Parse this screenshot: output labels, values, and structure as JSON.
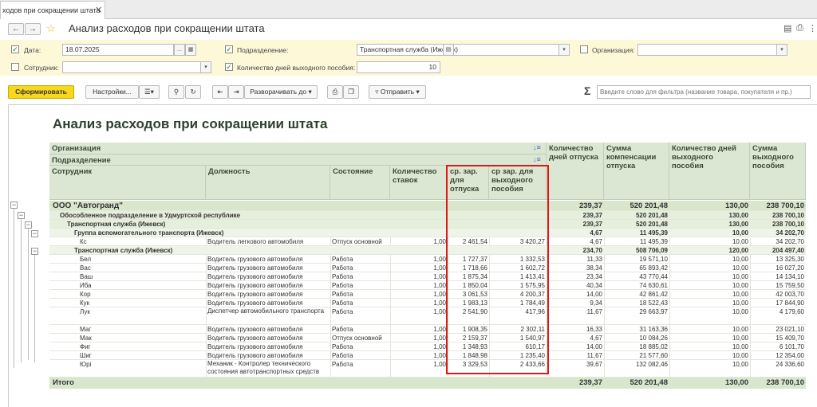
{
  "tab": {
    "title": "ходов при сокращении штата",
    "close": "✕"
  },
  "form": {
    "title": "Анализ расходов при сокращении штата"
  },
  "params": {
    "date_label": "Дата:",
    "date_value": "18.07.2025",
    "employee_label": "Сотрудник:",
    "employee_value": "",
    "division_label": "Подразделение:",
    "division_value": "Транспортная служба (Ижевск)",
    "org_label": "Организация:",
    "org_value": "",
    "days_label": "Количество дней выходного пособия:",
    "days_value": "10"
  },
  "toolbar": {
    "generate": "Сформировать",
    "settings": "Настройки...",
    "expand": "Разворачивать до",
    "send": "Отправить",
    "filter_placeholder": "Введите слово для фильтра (название товара, покупателя и пр.)",
    "sum_icon": "Σ"
  },
  "report": {
    "title": "Анализ расходов при сокращении штата",
    "headers": {
      "org": "Организация",
      "division": "Подразделение",
      "employee": "Сотрудник",
      "position": "Должность",
      "status": "Состояние",
      "rate": "Количество ставок",
      "avg_vac": "ср. зар. для отпуска",
      "avg_sev": "ср зар. для выходного пособия",
      "vac_days": "Количество дней отпуска",
      "vac_comp": "Сумма компенсации отпуска",
      "sev_days": "Количество дней выходного пособия",
      "sev_sum": "Сумма выходного пособия"
    },
    "groups": [
      {
        "label": "ООО \"Автогранд\"",
        "vac_days": "239,37",
        "vac_comp": "520 201,48",
        "sev_days": "130,00",
        "sev_sum": "238 700,10"
      },
      {
        "label": "Обособленное подразделение в Удмуртской республике",
        "vac_days": "239,37",
        "vac_comp": "520 201,48",
        "sev_days": "130,00",
        "sev_sum": "238 700,10"
      },
      {
        "label": "Транспортная служба (Ижевск)",
        "vac_days": "239,37",
        "vac_comp": "520 201,48",
        "sev_days": "130,00",
        "sev_sum": "238 700,10"
      },
      {
        "label": "Группа вспомогательного транспорта (Ижевск)",
        "vac_days": "4,67",
        "vac_comp": "11 495,39",
        "sev_days": "10,00",
        "sev_sum": "34 202,70"
      },
      {
        "label": "Транспортная служба (Ижевск)",
        "vac_days": "234,70",
        "vac_comp": "508 706,09",
        "sev_days": "120,00",
        "sev_sum": "204 497,40"
      }
    ],
    "rows": [
      {
        "emp": "Кс",
        "pos": "Водитель легкового автомобиля",
        "status": "Отпуск основной",
        "rate": "1,00",
        "avg_vac": "2 461,54",
        "avg_sev": "3 420,27",
        "vac_days": "4,67",
        "vac_comp": "11 495,39",
        "sev_days": "10,00",
        "sev_sum": "34 202,70"
      },
      {
        "emp": "Бел",
        "pos": "Водитель грузового автомобиля",
        "status": "Работа",
        "rate": "1,00",
        "avg_vac": "1 727,37",
        "avg_sev": "1 332,53",
        "vac_days": "11,33",
        "vac_comp": "19 571,10",
        "sev_days": "10,00",
        "sev_sum": "13 325,30"
      },
      {
        "emp": "Вас",
        "pos": "Водитель грузового автомобиля",
        "status": "Работа",
        "rate": "1,00",
        "avg_vac": "1 718,66",
        "avg_sev": "1 602,72",
        "vac_days": "38,34",
        "vac_comp": "65 893,42",
        "sev_days": "10,00",
        "sev_sum": "16 027,20"
      },
      {
        "emp": "Ваш",
        "pos": "Водитель грузового автомобиля",
        "status": "Работа",
        "rate": "1,00",
        "avg_vac": "1 875,34",
        "avg_sev": "1 413,41",
        "vac_days": "23,34",
        "vac_comp": "43 770,44",
        "sev_days": "10,00",
        "sev_sum": "14 134,10"
      },
      {
        "emp": "Иба",
        "pos": "Водитель грузового автомобиля",
        "status": "Работа",
        "rate": "1,00",
        "avg_vac": "1 850,04",
        "avg_sev": "1 575,95",
        "vac_days": "40,34",
        "vac_comp": "74 630,61",
        "sev_days": "10,00",
        "sev_sum": "15 759,50"
      },
      {
        "emp": "Кор",
        "pos": "Водитель грузового автомобиля",
        "status": "Работа",
        "rate": "1,00",
        "avg_vac": "3 061,53",
        "avg_sev": "4 200,37",
        "vac_days": "14,00",
        "vac_comp": "42 861,42",
        "sev_days": "10,00",
        "sev_sum": "42 003,70"
      },
      {
        "emp": "Кук",
        "pos": "Водитель грузового автомобиля",
        "status": "Работа",
        "rate": "1,00",
        "avg_vac": "1 983,13",
        "avg_sev": "1 784,49",
        "vac_days": "9,34",
        "vac_comp": "18 522,43",
        "sev_days": "10,00",
        "sev_sum": "17 844,90"
      },
      {
        "emp": "Лук",
        "pos": "Диспетчер автомобильного транспорта",
        "status": "Работа",
        "rate": "1,00",
        "avg_vac": "2 541,90",
        "avg_sev": "417,96",
        "vac_days": "11,67",
        "vac_comp": "29 663,97",
        "sev_days": "10,00",
        "sev_sum": "4 179,60"
      },
      {
        "emp": "Маг",
        "pos": "Водитель грузового автомобиля",
        "status": "Работа",
        "rate": "1,00",
        "avg_vac": "1 908,35",
        "avg_sev": "2 302,11",
        "vac_days": "16,33",
        "vac_comp": "31 163,36",
        "sev_days": "10,00",
        "sev_sum": "23 021,10"
      },
      {
        "emp": "Мак",
        "pos": "Водитель грузового автомобиля",
        "status": "Отпуск основной",
        "rate": "1,00",
        "avg_vac": "2 159,37",
        "avg_sev": "1 540,97",
        "vac_days": "4,67",
        "vac_comp": "10 084,26",
        "sev_days": "10,00",
        "sev_sum": "15 409,70"
      },
      {
        "emp": "Фиг",
        "pos": "Водитель грузового автомобиля",
        "status": "Работа",
        "rate": "1,00",
        "avg_vac": "1 348,93",
        "avg_sev": "610,17",
        "vac_days": "14,00",
        "vac_comp": "18 885,02",
        "sev_days": "10,00",
        "sev_sum": "6 101,70"
      },
      {
        "emp": "Шиг",
        "pos": "Водитель грузового автомобиля",
        "status": "Работа",
        "rate": "1,00",
        "avg_vac": "1 848,98",
        "avg_sev": "1 235,40",
        "vac_days": "11,67",
        "vac_comp": "21 577,60",
        "sev_days": "10,00",
        "sev_sum": "12 354,00"
      },
      {
        "emp": "Юрі",
        "pos": "Механик - Контролер технического состояния автотранспортных средств",
        "status": "Работа",
        "rate": "1,00",
        "avg_vac": "3 329,53",
        "avg_sev": "2 433,66",
        "vac_days": "39,67",
        "vac_comp": "132 082,46",
        "sev_days": "10,00",
        "sev_sum": "24 336,60"
      }
    ],
    "total": {
      "label": "Итого",
      "vac_days": "239,37",
      "vac_comp": "520 201,48",
      "sev_days": "130,00",
      "sev_sum": "238 700,10"
    }
  }
}
